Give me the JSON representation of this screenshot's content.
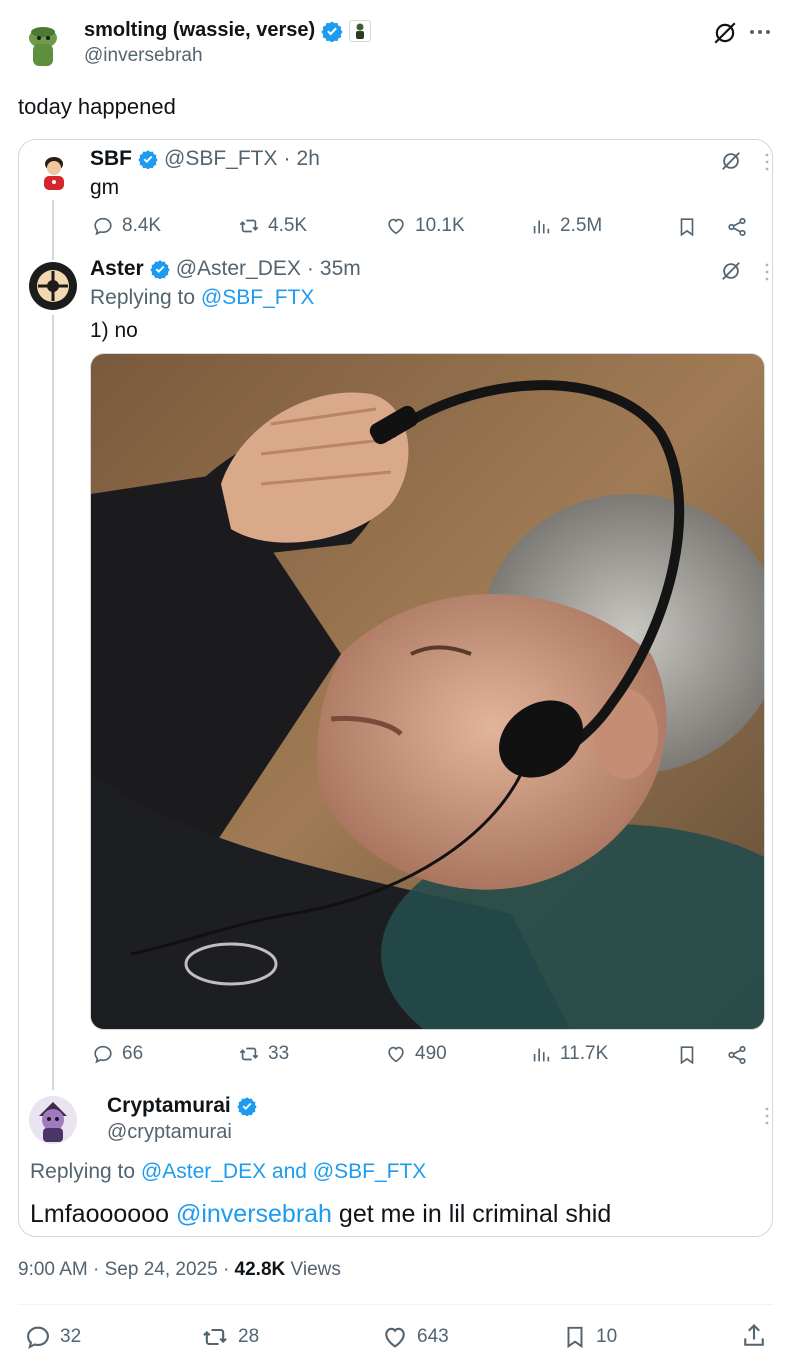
{
  "author": {
    "name": "smolting (wassie, verse)",
    "handle": "@inversebrah",
    "tweet_text": "today happened"
  },
  "quote": {
    "sbf": {
      "name": "SBF",
      "handle": "@SBF_FTX",
      "time": "2h",
      "text": "gm",
      "stats": {
        "replies": "8.4K",
        "reposts": "4.5K",
        "likes": "10.1K",
        "views": "2.5M"
      }
    },
    "aster": {
      "name": "Aster",
      "handle": "@Aster_DEX",
      "time": "35m",
      "replying_prefix": "Replying to",
      "replying_to": "@SBF_FTX",
      "text": "1) no",
      "stats": {
        "replies": "66",
        "reposts": "33",
        "likes": "490",
        "views": "11.7K"
      }
    },
    "cryptamurai": {
      "name": "Cryptamurai",
      "handle": "@cryptamurai",
      "replying_prefix": "Replying to",
      "replying_to": "@Aster_DEX and @SBF_FTX",
      "text_pre": "Lmfaoooooo ",
      "mention": "@inversebrah",
      "text_post": " get me in lil criminal shid"
    }
  },
  "meta": {
    "time": "9:00 AM",
    "date": "Sep 24, 2025",
    "views_count": "42.8K",
    "views_label": "Views"
  },
  "actions": {
    "replies": "32",
    "reposts": "28",
    "likes": "643",
    "bookmarks": "10"
  },
  "colors": {
    "accent": "#1d9bf0",
    "muted": "#536471",
    "border": "#cfd9de"
  }
}
